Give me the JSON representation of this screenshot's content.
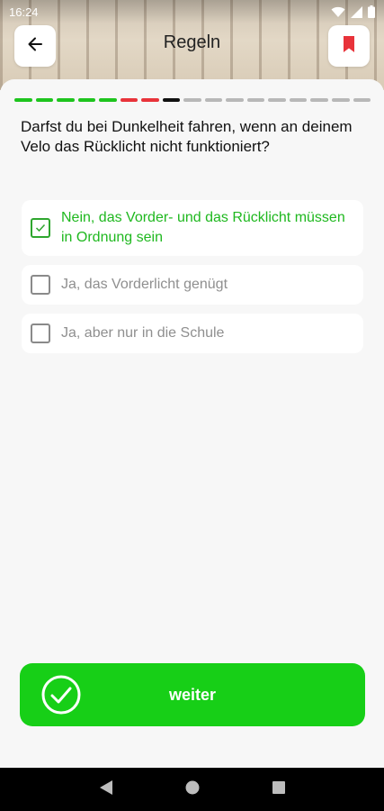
{
  "status_bar": {
    "time": "16:24"
  },
  "header": {
    "title": "Regeln"
  },
  "progress": {
    "segments": [
      "#1ec41e",
      "#1ec41e",
      "#1ec41e",
      "#1ec41e",
      "#1ec41e",
      "#e8333a",
      "#e8333a",
      "#111111",
      "#b8b8b8",
      "#b8b8b8",
      "#b8b8b8",
      "#b8b8b8",
      "#b8b8b8",
      "#b8b8b8",
      "#b8b8b8",
      "#b8b8b8",
      "#b8b8b8"
    ]
  },
  "question": {
    "text": "Darfst du bei Dunkelheit fahren, wenn an deinem Velo das Rücklicht nicht funktioniert?"
  },
  "options": [
    {
      "label": "Nein, das Vorder- und das Rücklicht müssen in Ordnung sein",
      "checked": true
    },
    {
      "label": "Ja, das Vorderlicht genügt",
      "checked": false
    },
    {
      "label": "Ja, aber nur in die Schule",
      "checked": false
    }
  ],
  "next_button": {
    "label": "weiter"
  },
  "colors": {
    "accent": "#17cf17",
    "bookmark": "#e8333a"
  },
  "icons": [
    "back-arrow-icon",
    "bookmark-icon",
    "check-circle-icon",
    "wifi-icon",
    "signal-icon",
    "battery-icon"
  ]
}
